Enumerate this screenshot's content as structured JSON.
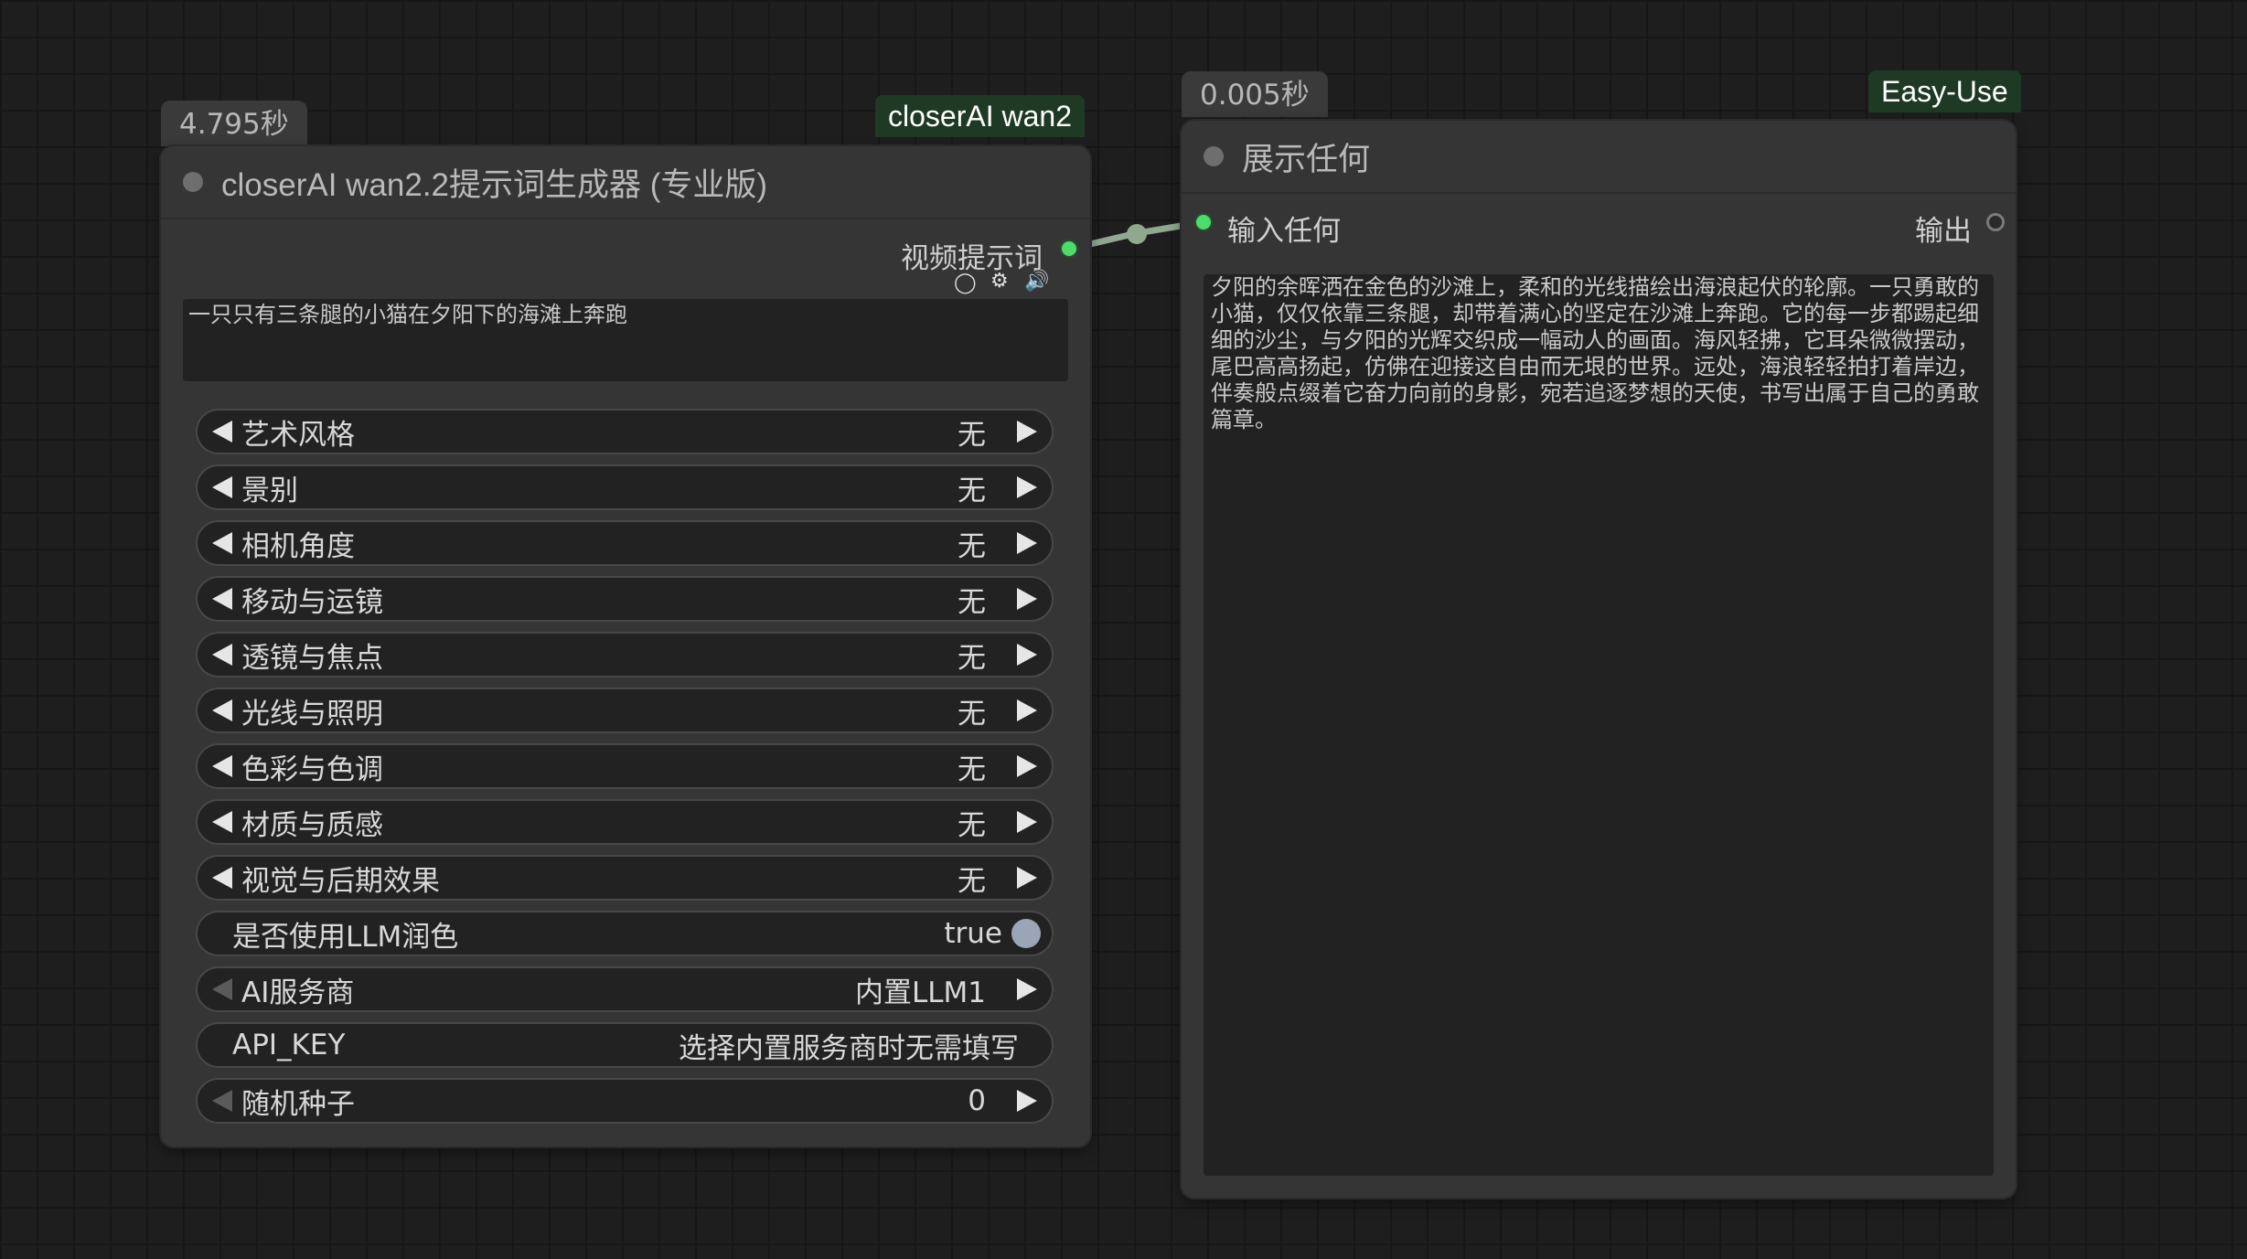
{
  "node1": {
    "time_badge": "4.795秒",
    "tag": "closerAI wan2",
    "title": "closerAI wan2.2提示词生成器 (专业版)",
    "output_label": "视频提示词",
    "prompt_text": "一只只有三条腿的小猫在夕阳下的海滩上奔跑",
    "icons": [
      "circle-icon",
      "gear-icon",
      "speaker-icon"
    ],
    "widgets": [
      {
        "label": "艺术风格",
        "value": "无"
      },
      {
        "label": "景别",
        "value": "无"
      },
      {
        "label": "相机角度",
        "value": "无"
      },
      {
        "label": "移动与运镜",
        "value": "无"
      },
      {
        "label": "透镜与焦点",
        "value": "无"
      },
      {
        "label": "光线与照明",
        "value": "无"
      },
      {
        "label": "色彩与色调",
        "value": "无"
      },
      {
        "label": "材质与质感",
        "value": "无"
      },
      {
        "label": "视觉与后期效果",
        "value": "无"
      }
    ],
    "toggle": {
      "label": "是否使用LLM润色",
      "value": "true"
    },
    "provider": {
      "label": "AI服务商",
      "value": "内置LLM1"
    },
    "api_key": {
      "label": "API_KEY",
      "value": "选择内置服务商时无需填写"
    },
    "seed": {
      "label": "随机种子",
      "value": "0"
    }
  },
  "node2": {
    "time_badge": "0.005秒",
    "tag": "Easy-Use",
    "title": "展示任何",
    "input_label": "输入任何",
    "output_label": "输出",
    "text": "夕阳的余晖洒在金色的沙滩上，柔和的光线描绘出海浪起伏的轮廓。一只勇敢的小猫，仅仅依靠三条腿，却带着满心的坚定在沙滩上奔跑。它的每一步都踢起细细的沙尘，与夕阳的光辉交织成一幅动人的画面。海风轻拂，它耳朵微微摆动，尾巴高高扬起，仿佛在迎接这自由而无垠的世界。远处，海浪轻轻拍打着岸边，伴奏般点缀着它奋力向前的身影，宛若追逐梦想的天使，书写出属于自己的勇敢篇章。"
  },
  "colors": {
    "canvas": "#1e1e1e",
    "node_bg": "#353535",
    "tag_bg": "#1f3a24",
    "socket_green": "#4cdc6a",
    "link": "#8fa88f"
  }
}
